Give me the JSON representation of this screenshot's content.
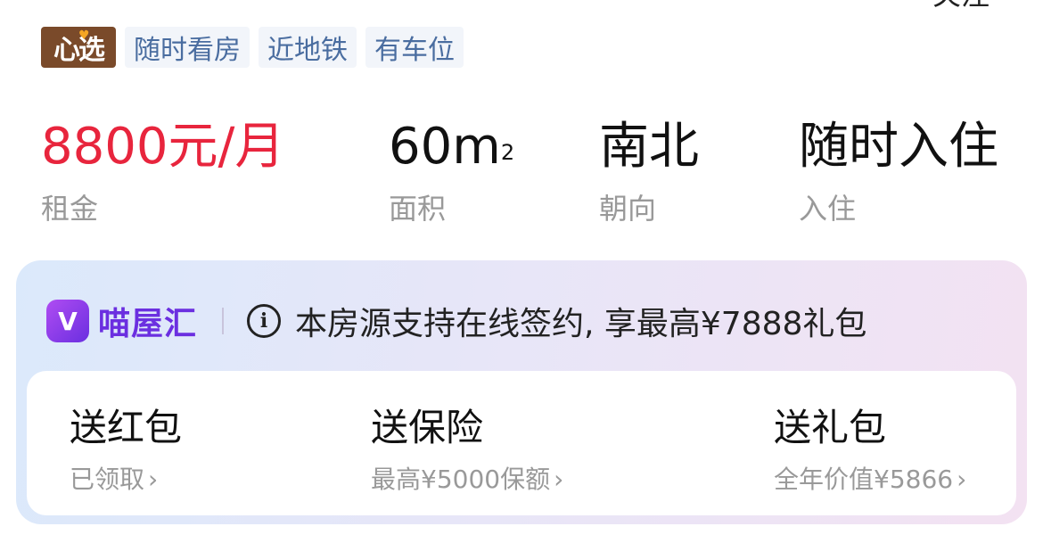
{
  "header": {
    "partial_text": "关注"
  },
  "tags": {
    "brand": "心选",
    "items": [
      "随时看房",
      "近地铁",
      "有车位"
    ]
  },
  "stats": {
    "rent": {
      "value": "8800元/月",
      "label": "租金"
    },
    "area": {
      "value": "60m",
      "unit_sup": "2",
      "label": "面积"
    },
    "orientation": {
      "value": "南北",
      "label": "朝向"
    },
    "move_in": {
      "value": "随时入住",
      "label": "入住"
    }
  },
  "promo": {
    "app_logo": "V",
    "app_name": "喵屋汇",
    "info_icon": "i",
    "text": "本房源支持在线签约, 享最高¥7888礼包",
    "benefits": [
      {
        "title": "送红包",
        "sub": "已领取"
      },
      {
        "title": "送保险",
        "sub": "最高¥5000保额"
      },
      {
        "title": "送礼包",
        "sub": "全年价值¥5866"
      }
    ],
    "chevron": "›"
  },
  "colors": {
    "price": "#e8253d",
    "tag_text": "#4a6da0",
    "tag_bg": "#f2f5fa",
    "brand_badge": "#7a4a2a",
    "app_purple": "#6b2fe0"
  },
  "icons": [
    "info-icon",
    "chevron-right-icon",
    "app-logo-icon"
  ]
}
